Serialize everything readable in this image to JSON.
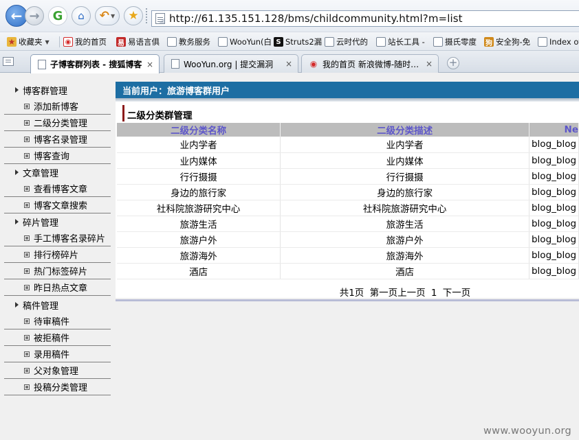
{
  "browser": {
    "address": "http://61.135.151.128/bms/childcommunity.html?m=list",
    "bookmarks": [
      {
        "label": "收藏夹",
        "icon": "favorites-folder-icon",
        "color": "#e9b63c"
      },
      {
        "label": "我的首页",
        "icon": "weibo-icon",
        "color": "#d42b2b"
      },
      {
        "label": "易语言俱",
        "icon": "yiyuyan-icon",
        "color": "#c22a2a"
      },
      {
        "label": "教务服务",
        "icon": "page-icon",
        "color": "#7a8798"
      },
      {
        "label": "WooYun(白",
        "icon": "page-icon",
        "color": "#7a8798"
      },
      {
        "label": "Struts2漏",
        "icon": "struts-icon",
        "color": "#111111"
      },
      {
        "label": "云时代的",
        "icon": "page-icon",
        "color": "#7a8798"
      },
      {
        "label": "站长工具 -",
        "icon": "page-icon",
        "color": "#7a8798"
      },
      {
        "label": "摄氏零度",
        "icon": "page-icon",
        "color": "#7a8798"
      },
      {
        "label": "安全狗-免",
        "icon": "safedog-icon",
        "color": "#d08a1c"
      },
      {
        "label": "Index of",
        "icon": "page-icon",
        "color": "#7a8798"
      }
    ],
    "tabs": [
      {
        "label": "子博客群列表 - 搜狐博客",
        "close": "×"
      },
      {
        "label": "WooYun.org | 提交漏洞",
        "close": "×"
      },
      {
        "label": "我的首页 新浪微博-随时…",
        "close": "×"
      }
    ],
    "new_tab": "+"
  },
  "menu": [
    {
      "label": "博客群管理",
      "items": [
        "添加新博客",
        "二级分类管理",
        "博客名录管理",
        "博客查询"
      ]
    },
    {
      "label": "文章管理",
      "items": [
        "查看博客文章",
        "博客文章搜索"
      ]
    },
    {
      "label": "碎片管理",
      "items": [
        "手工博客名录碎片",
        "排行榜碎片",
        "热门标签碎片",
        "昨日热点文章"
      ]
    },
    {
      "label": "稿件管理",
      "items": [
        "待审稿件",
        "被拒稿件",
        "录用稿件",
        "父对象管理",
        "投稿分类管理"
      ]
    }
  ],
  "content": {
    "user_bar": "当前用户：旅游博客群用户",
    "section_title": "二级分类群管理",
    "table": {
      "headers": [
        "二级分类名称",
        "二级分类描述",
        "Ne"
      ],
      "rows": [
        [
          "业内学者",
          "业内学者",
          "blog_blog"
        ],
        [
          "业内媒体",
          "业内媒体",
          "blog_blog"
        ],
        [
          "行行摄摄",
          "行行摄摄",
          "blog_blog"
        ],
        [
          "身边的旅行家",
          "身边的旅行家",
          "blog_blog"
        ],
        [
          "社科院旅游研究中心",
          "社科院旅游研究中心",
          "blog_blog"
        ],
        [
          "旅游生活",
          "旅游生活",
          "blog_blog"
        ],
        [
          "旅游户外",
          "旅游户外",
          "blog_blog"
        ],
        [
          "旅游海外",
          "旅游海外",
          "blog_blog"
        ],
        [
          "酒店",
          "酒店",
          "blog_blog"
        ]
      ]
    },
    "pager": {
      "total": "共1页",
      "first": "第一页",
      "prev": "上一页",
      "current": "1",
      "next": "下一页"
    }
  },
  "watermark": "www.wooyun.org"
}
